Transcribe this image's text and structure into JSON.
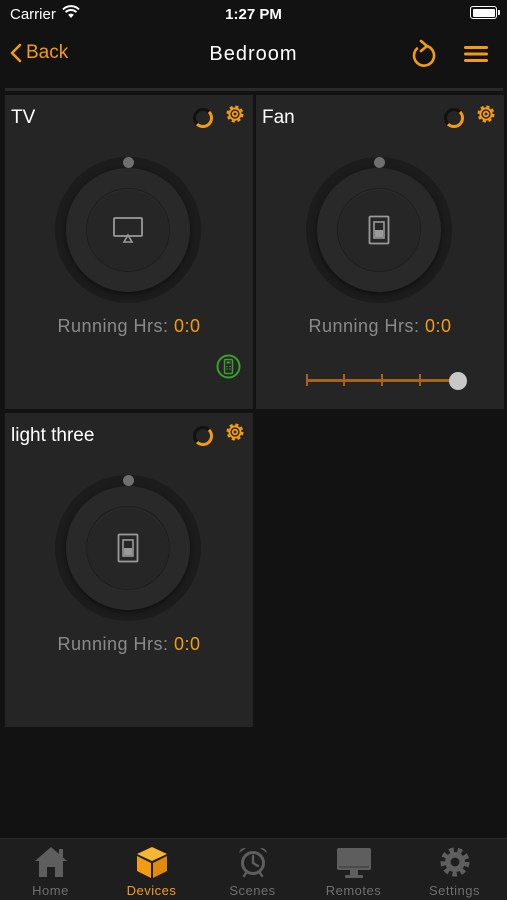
{
  "status_bar": {
    "carrier": "Carrier",
    "time": "1:27 PM"
  },
  "nav": {
    "back_label": "Back",
    "title": "Bedroom"
  },
  "devices": [
    {
      "name": "TV",
      "running_label": "Running Hrs:",
      "running_value": "0:0",
      "power": "off"
    },
    {
      "name": "Fan",
      "running_label": "Running Hrs:",
      "running_value": "0:0",
      "power": "off",
      "speed_level": 1.0
    },
    {
      "name": "light three",
      "running_label": "Running Hrs:",
      "running_value": "0:0",
      "power": "off"
    }
  ],
  "tabs": [
    {
      "label": "Home",
      "icon": "home-icon",
      "active": false
    },
    {
      "label": "Devices",
      "icon": "cube-icon",
      "active": true
    },
    {
      "label": "Scenes",
      "icon": "alarm-clock-icon",
      "active": false
    },
    {
      "label": "Remotes",
      "icon": "monitor-icon",
      "active": false
    },
    {
      "label": "Settings",
      "icon": "gear-icon",
      "active": false
    }
  ],
  "colors": {
    "accent": "#f39c12",
    "background": "#121212",
    "card": "#252525",
    "remote_icon": "#3c9e2e"
  }
}
